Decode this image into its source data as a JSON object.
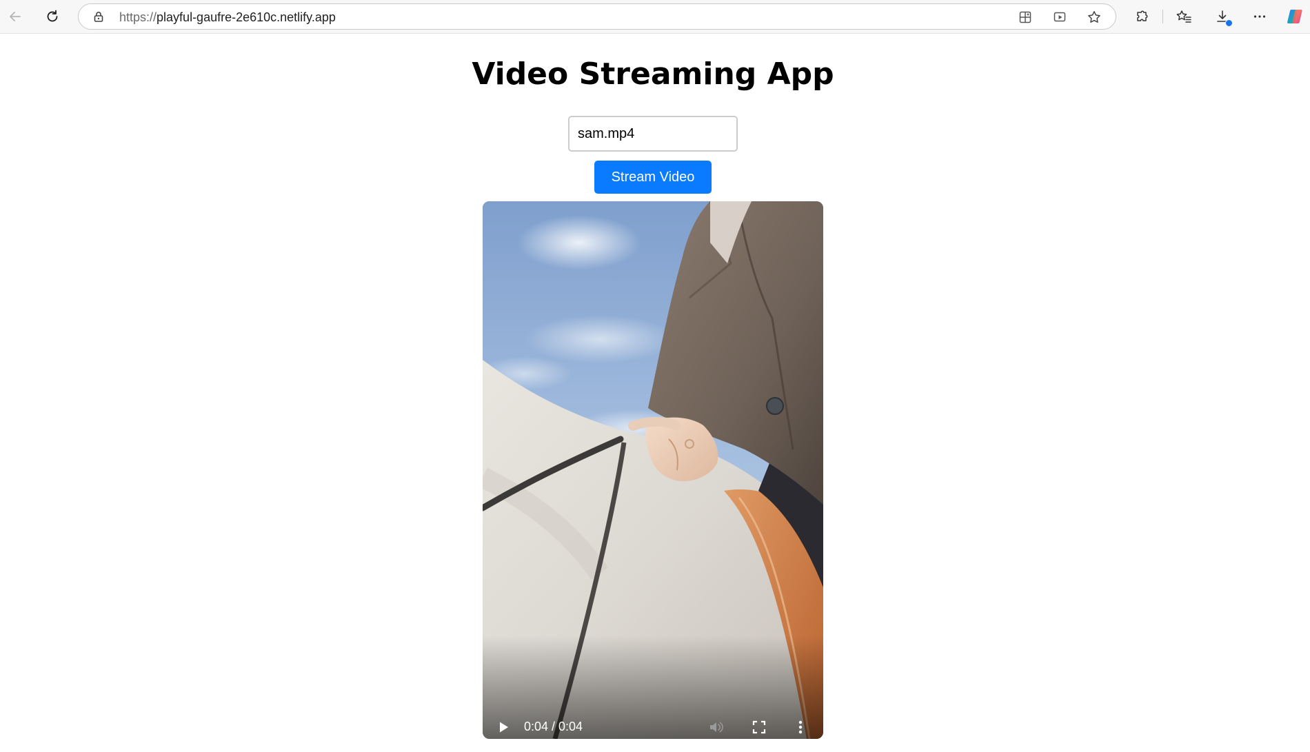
{
  "browser": {
    "url_scheme": "https://",
    "url_host": "playful-gaufre-2e610c.netlify.app",
    "download_badge_color": "#1a73e8"
  },
  "icons": {
    "back": "back-arrow-icon",
    "refresh": "refresh-icon",
    "lock": "lock-icon",
    "apps": "apps-icon",
    "media": "media-icon",
    "favorite": "star-icon",
    "extensions": "puzzle-icon",
    "favorites": "favorites-icon",
    "downloads": "download-icon",
    "menu": "more-icon",
    "copilot": "copilot-icon",
    "play": "play-icon",
    "mute": "volume-icon",
    "fullscreen": "fullscreen-icon",
    "options": "more-vertical-icon"
  },
  "page": {
    "title": "Video Streaming App",
    "filename_input_value": "sam.mp4",
    "stream_button_label": "Stream Video"
  },
  "video": {
    "current_time": "0:04",
    "duration": "0:04",
    "time_display": "0:04 / 0:04",
    "progress_fraction": 1.0
  },
  "colors": {
    "accent": "#0a7bff",
    "input_border": "#cccccc",
    "title": "#000000"
  }
}
